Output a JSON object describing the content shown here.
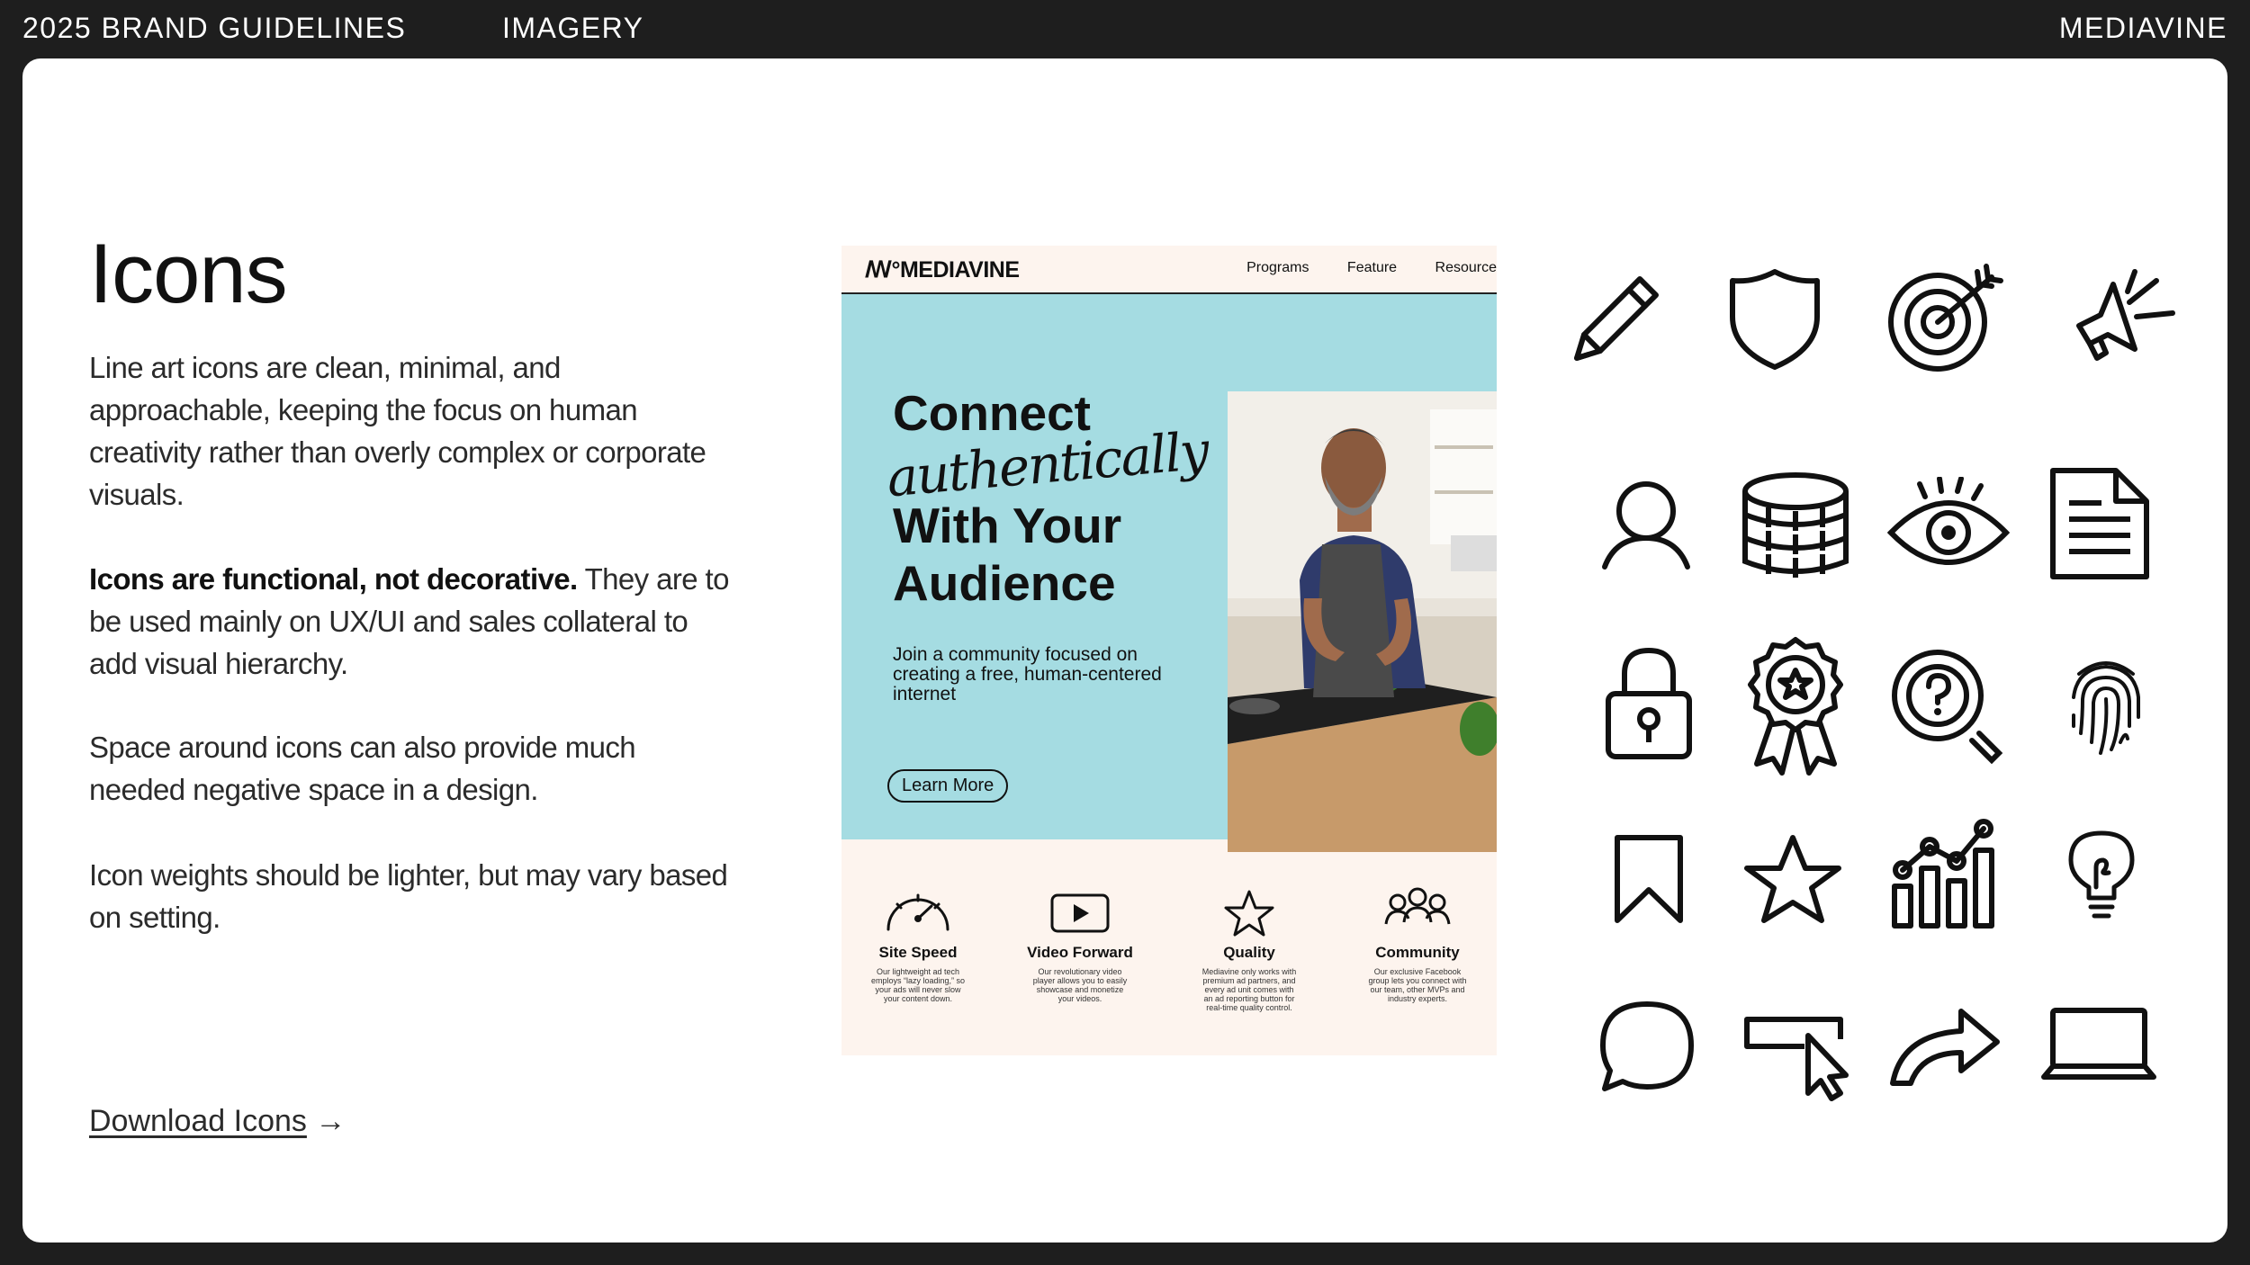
{
  "topbar": {
    "doc_title": "2025 BRAND GUIDELINES",
    "section": "IMAGERY",
    "brand": "MEDIAVINE"
  },
  "page": {
    "title": "Icons",
    "p1": "Line art icons are clean, minimal, and approachable, keeping the focus on human creativity rather than overly complex or corporate visuals.",
    "p2_bold": "Icons are functional, not decorative.",
    "p2_rest": " They are to be used mainly on UX/UI and sales collateral to add visual hierarchy.",
    "p3": "Space around icons can also provide much needed negative space in a design.",
    "p4": "Icon weights should be lighter, but may vary based on setting.",
    "download_label": "Download Icons",
    "download_arrow": "→"
  },
  "mockup": {
    "logo": "MEDIAVINE",
    "logo_mark": "ꟿ°",
    "nav": [
      "Programs",
      "Feature",
      "Resource"
    ],
    "hero": {
      "line1": "Connect",
      "script": "authentically",
      "line3": "With Your",
      "line4": "Audience",
      "sub": "Join a community focused on creating a free, human-centered internet",
      "button": "Learn More"
    },
    "features": [
      {
        "label": "Site Speed",
        "desc": "Our lightweight ad tech employs “lazy loading,” so your ads will never slow your content down.",
        "icon": "speedometer-icon"
      },
      {
        "label": "Video Forward",
        "desc": "Our revolutionary video player allows you to easily showcase and monetize your videos.",
        "icon": "play-icon"
      },
      {
        "label": "Quality",
        "desc": "Mediavine only works with premium ad partners, and every ad unit comes with an ad reporting button for real-time quality control.",
        "icon": "star-icon"
      },
      {
        "label": "Community",
        "desc": "Our exclusive Facebook group lets you connect with our team, other MVPs and industry experts.",
        "icon": "people-icon"
      }
    ]
  },
  "icons": [
    "pencil-icon",
    "shield-icon",
    "target-icon",
    "megaphone-icon",
    "user-icon",
    "coins-icon",
    "eye-icon",
    "document-icon",
    "lock-icon",
    "award-badge-icon",
    "search-question-icon",
    "fingerprint-icon",
    "bookmark-icon",
    "star-icon",
    "bar-chart-icon",
    "lightbulb-icon",
    "chat-bubble-icon",
    "click-button-icon",
    "share-arrow-icon",
    "laptop-icon"
  ]
}
